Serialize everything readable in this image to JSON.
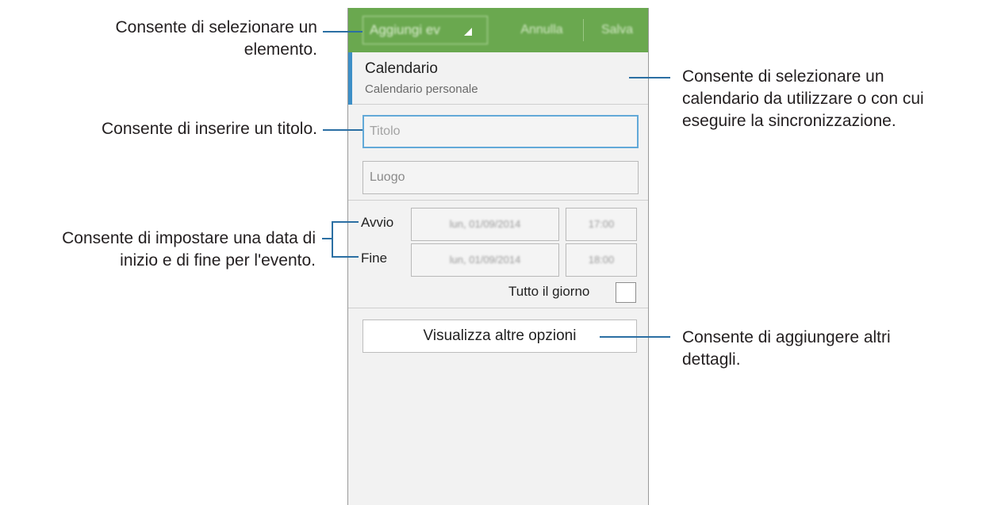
{
  "action_bar": {
    "add_label": "Aggiungi ev",
    "cancel_label": "Annulla",
    "save_label": "Salva"
  },
  "calendar": {
    "title": "Calendario",
    "subtitle": "Calendario personale"
  },
  "fields": {
    "title_placeholder": "Titolo",
    "place_placeholder": "Luogo"
  },
  "dates": {
    "start_label": "Avvio",
    "start_date": "lun, 01/09/2014",
    "start_time": "17:00",
    "end_label": "Fine",
    "end_date": "lun, 01/09/2014",
    "end_time": "18:00"
  },
  "all_day_label": "Tutto il giorno",
  "more_options_label": "Visualizza altre opzioni",
  "annotations": {
    "select_item": [
      "Consente di selezionare un",
      "elemento."
    ],
    "enter_title": "Consente di inserire un titolo.",
    "set_dates": [
      "Consente di impostare una data di",
      "inizio e di fine per l'evento."
    ],
    "select_calendar": [
      "Consente di selezionare un",
      "calendario da utilizzare o con cui",
      "eseguire la sincronizzazione."
    ],
    "add_details": [
      "Consente di aggiungere altri",
      "dettagli."
    ]
  },
  "colors": {
    "action_bar": "#6aa84f",
    "accent": "#3d8fc7",
    "callout_line": "#2b6fa3"
  }
}
